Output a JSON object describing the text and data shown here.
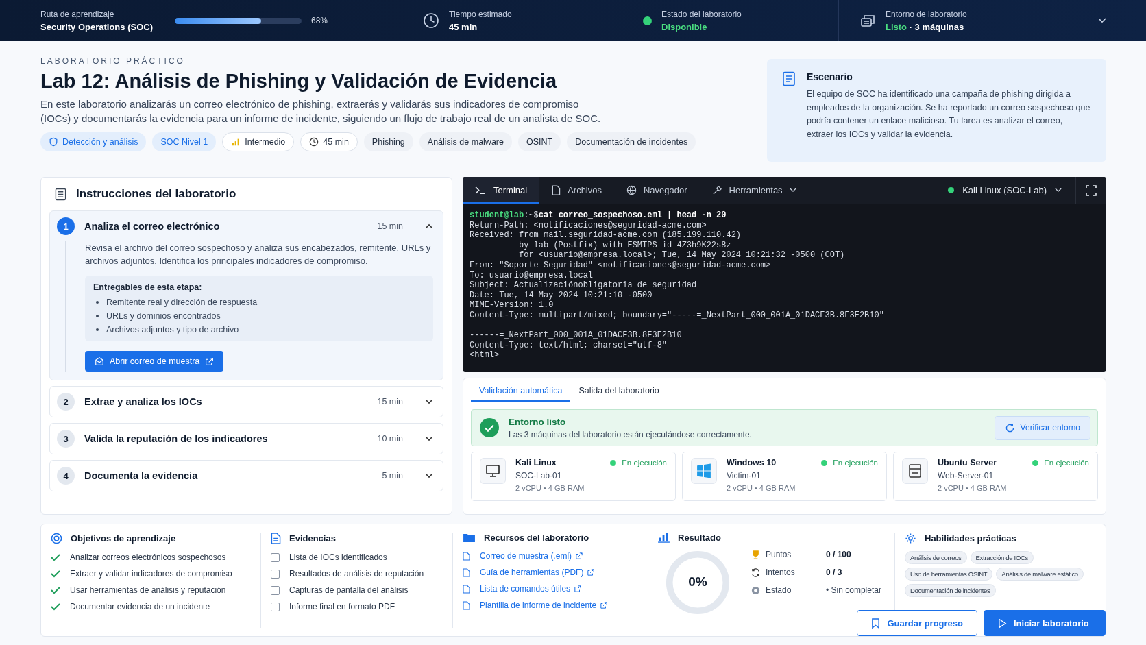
{
  "top_bar": {
    "path": {
      "label": "Ruta de aprendizaje",
      "value": "Security Operations (SOC)",
      "level": 0.68,
      "percent": "68%"
    },
    "time": {
      "label": "Tiempo estimado",
      "value": "45 min"
    },
    "status": {
      "label": "Estado del laboratorio",
      "value": "Disponible"
    },
    "environment": {
      "label": "Entorno de laboratorio",
      "status": "Listo",
      "detail": "· 3 máquinas"
    }
  },
  "lab": {
    "eyebrow": "LABORATORIO PRÁCTICO",
    "title": "Lab 12: Análisis de Phishing y Validación de Evidencia",
    "description": "En este laboratorio analizarás un correo electrónico de phishing, extraerás y validarás sus indicadores de compromiso (IOCs) y documentarás la evidencia para un informe de incidente, siguiendo un flujo de trabajo real de un analista de SOC.",
    "tags": [
      {
        "kind": "category",
        "label": "Detección y análisis"
      },
      {
        "kind": "level",
        "label": "SOC Nivel 1"
      },
      {
        "kind": "difficulty",
        "label": "Intermedio"
      },
      {
        "kind": "duration",
        "label": "45 min"
      },
      {
        "kind": "topic",
        "label": "Phishing"
      },
      {
        "kind": "topic",
        "label": "Análisis de malware"
      },
      {
        "kind": "topic",
        "label": "OSINT"
      },
      {
        "kind": "topic",
        "label": "Documentación de incidentes"
      }
    ]
  },
  "scenario": {
    "title": "Escenario",
    "text": "El equipo de SOC ha identificado una campaña de phishing dirigida a empleados de la organización. Se ha reportado un correo sospechoso que podría contener un enlace malicioso. Tu tarea es analizar el correo, extraer los IOCs y validar la evidencia."
  },
  "instructions": {
    "title": "Instrucciones del laboratorio",
    "steps": [
      {
        "number": "1",
        "title": "Analiza el correo electrónico",
        "duration": "15 min",
        "expanded": true,
        "description": "Revisa el archivo del correo sospechoso y analiza sus encabezados, remitente, URLs y archivos adjuntos. Identifica los principales indicadores de compromiso.",
        "deliverables_title": "Entregables de esta etapa:",
        "deliverables": [
          "Remitente real y dirección de respuesta",
          "URLs y dominios encontrados",
          "Archivos adjuntos y tipo de archivo"
        ],
        "action": "Abrir correo de muestra"
      },
      {
        "number": "2",
        "title": "Extrae y analiza los IOCs",
        "duration": "15 min",
        "expanded": false
      },
      {
        "number": "3",
        "title": "Valida la reputación de los indicadores",
        "duration": "10 min",
        "expanded": false
      },
      {
        "number": "4",
        "title": "Documenta la evidencia",
        "duration": "5 min",
        "expanded": false
      }
    ]
  },
  "workspace": {
    "tabs": [
      {
        "kind": "terminal",
        "label": "Terminal",
        "selected": true
      },
      {
        "kind": "files",
        "label": "Archivos",
        "selected": false
      },
      {
        "kind": "browser",
        "label": "Navegador",
        "selected": false
      },
      {
        "kind": "tools",
        "label": "Herramientas",
        "selected": false
      }
    ],
    "machine_select": "Kali Linux (SOC-Lab)",
    "terminal": {
      "prompt": "student@lab",
      "path": ":~$",
      "command": "cat correo_sospechoso.eml | head -n 20",
      "headers": [
        "Return-Path: <notificaciones@seguridad-acme.com>",
        "Received: from mail.seguridad-acme.com (185.199.110.42)",
        "          by lab (Postfix) with ESMTPS id 4Z3h9K22s8z",
        "          for <usuario@empresa.local>; Tue, 14 May 2024 10:21:32 -0500 (COT)",
        "From: \"Soporte Seguridad\" <notificaciones@seguridad-acme.com>",
        "To: usuario@empresa.local",
        "Subject: Actualizaciónobligatoria de seguridad",
        "Date: Tue, 14 May 2024 10:21:10 -0500",
        "MIME-Version: 1.0",
        "Content-Type: multipart/mixed; boundary=\"-----=_NextPart_000_001A_01DACF3B.8F3E2B10\""
      ],
      "body": [
        "------=_NextPart_000_001A_01DACF3B.8F3E2B10",
        "Content-Type: text/html; charset=\"utf-8\"",
        "<html>"
      ]
    }
  },
  "validation": {
    "tabs": [
      {
        "label": "Validación automática",
        "selected": true
      },
      {
        "label": "Salida del laboratorio",
        "selected": false
      }
    ],
    "banner": {
      "title": "Entorno listo",
      "text": "Las 3 máquinas del laboratorio están ejecutándose correctamente.",
      "button": "Verificar entorno"
    },
    "machines": [
      {
        "kind": "desktop",
        "name": "Kali Linux",
        "status": "En ejecución",
        "host": "SOC-Lab-01",
        "specs": "2 vCPU • 4 GB RAM"
      },
      {
        "kind": "windows",
        "name": "Windows 10",
        "status": "En ejecución",
        "host": "Victim-01",
        "specs": "2 vCPU • 4 GB RAM"
      },
      {
        "kind": "server",
        "name": "Ubuntu Server",
        "status": "En ejecución",
        "host": "Web-Server-01",
        "specs": "2 vCPU • 4 GB RAM"
      }
    ]
  },
  "objectives": {
    "title": "Objetivos de aprendizaje",
    "items": [
      {
        "label": "Analizar correos electrónicos sospechosos",
        "checked": true
      },
      {
        "label": "Extraer y validar indicadores de compromiso",
        "checked": true
      },
      {
        "label": "Usar herramientas de análisis y reputación",
        "checked": true
      },
      {
        "label": "Documentar evidencia de un incidente",
        "checked": true
      }
    ]
  },
  "evidence": {
    "title": "Evidencias",
    "items": [
      {
        "label": "Lista de IOCs identificados",
        "checked": false
      },
      {
        "label": "Resultados de análisis de reputación",
        "checked": false
      },
      {
        "label": "Capturas de pantalla del análisis",
        "checked": false
      },
      {
        "label": "Informe final en formato PDF",
        "checked": false
      }
    ]
  },
  "resources": {
    "title": "Recursos del laboratorio",
    "links": [
      "Correo de muestra (.eml)",
      "Guía de herramientas (PDF)",
      "Lista de comandos útiles",
      "Plantilla de informe de incidente"
    ]
  },
  "result": {
    "title": "Resultado",
    "percent": "0%",
    "level": 0,
    "stats": [
      {
        "kind": "points",
        "label": "Puntos",
        "value": "0 / 100"
      },
      {
        "kind": "attempts",
        "label": "Intentos",
        "value": "0 / 3"
      },
      {
        "kind": "status",
        "label": "Estado",
        "value": "• Sin completar"
      }
    ]
  },
  "skills": {
    "title": "Habilidades prácticas",
    "chips": [
      "Análisis de correos",
      "Extracción de IOCs",
      "Uso de herramientas OSINT",
      "Análisis de malware estático",
      "Documentación de incidentes"
    ]
  },
  "actions": {
    "save": "Guardar progreso",
    "start": "Iniciar laboratorio"
  }
}
